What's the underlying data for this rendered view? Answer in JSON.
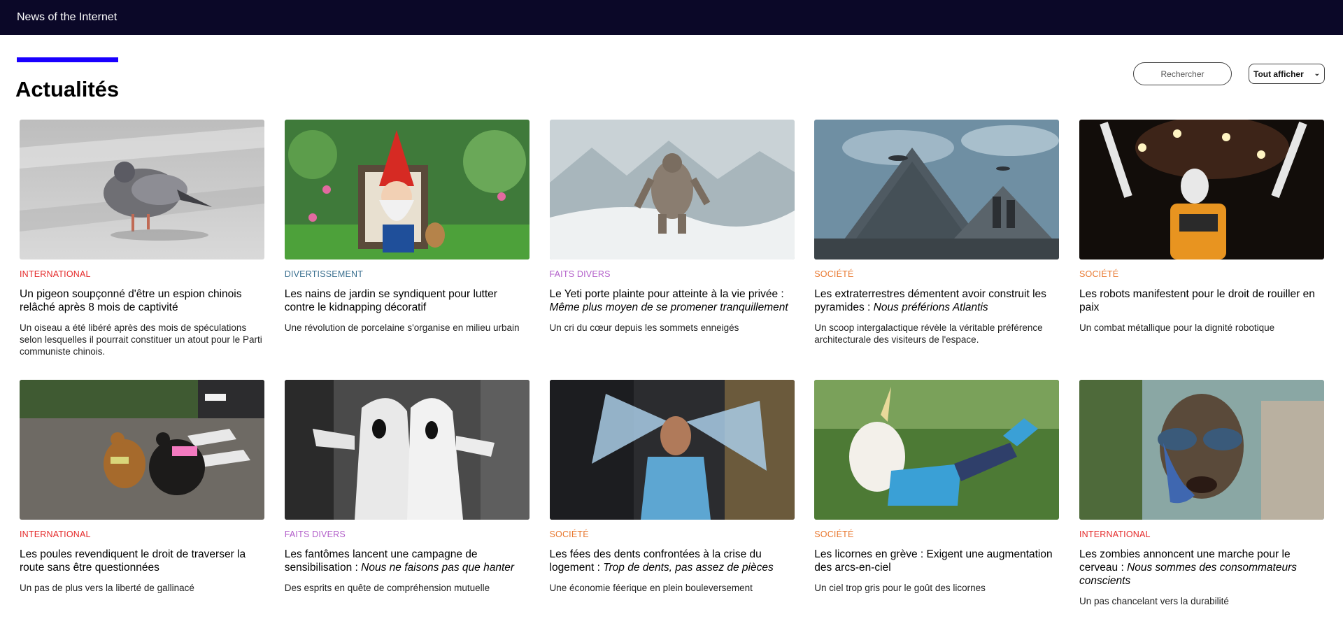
{
  "app": {
    "title": "News of the Internet"
  },
  "page": {
    "title": "Actualités"
  },
  "controls": {
    "search_label": "Rechercher",
    "filter_value": "Tout afficher"
  },
  "colors": {
    "topbar": "#0b0828",
    "accent": "#1a00ff",
    "international": "#e52b2b",
    "divertissement": "#3a6f8f",
    "faits_divers": "#b25ec9",
    "societe": "#e8772e"
  },
  "articles": [
    {
      "category": "INTERNATIONAL",
      "category_color": "#e52b2b",
      "title": "Un pigeon soupçonné d'être un espion chinois relâché après 8 mois de captivité",
      "title_italic": "",
      "desc": "Un oiseau a été libéré après des mois de spéculations selon lesquelles il pourrait constituer un atout pour le Parti communiste chinois.",
      "image": "pigeon"
    },
    {
      "category": "DIVERTISSEMENT",
      "category_color": "#3a6f8f",
      "title": "Les nains de jardin se syndiquent pour lutter contre le kidnapping décoratif",
      "title_italic": "",
      "desc": "Une révolution de porcelaine s'organise en milieu urbain",
      "image": "garden-gnome"
    },
    {
      "category": "FAITS DIVERS",
      "category_color": "#b25ec9",
      "title": "Le Yeti porte plainte pour atteinte à la vie privée : ",
      "title_italic": "Même plus moyen de se promener tranquillement",
      "desc": "Un cri du cœur depuis les sommets enneigés",
      "image": "yeti"
    },
    {
      "category": "SOCIÉTÉ",
      "category_color": "#e8772e",
      "title": "Les extraterrestres démentent avoir construit les pyramides : ",
      "title_italic": "Nous préférions Atlantis",
      "desc": "Un scoop intergalactique révèle la véritable préférence architecturale des visiteurs de l'espace.",
      "image": "pyramids-aliens"
    },
    {
      "category": "SOCIÉTÉ",
      "category_color": "#e8772e",
      "title": "Les robots manifestent pour le droit de rouiller en paix",
      "title_italic": "",
      "desc": "Un combat métallique pour la dignité robotique",
      "image": "robot"
    },
    {
      "category": "INTERNATIONAL",
      "category_color": "#e52b2b",
      "title": "Les poules revendiquent le droit de traverser la route sans être questionnées",
      "title_italic": "",
      "desc": "Un pas de plus vers la liberté de gallinacé",
      "image": "chickens"
    },
    {
      "category": "FAITS DIVERS",
      "category_color": "#b25ec9",
      "title": "Les fantômes lancent une campagne de sensibilisation : ",
      "title_italic": "Nous ne faisons pas que hanter",
      "desc": "Des esprits en quête de compréhension mutuelle",
      "image": "ghosts"
    },
    {
      "category": "SOCIÉTÉ",
      "category_color": "#e8772e",
      "title": "Les fées des dents confrontées à la crise du logement : ",
      "title_italic": "Trop de dents, pas assez de pièces",
      "desc": "Une économie féerique en plein bouleversement",
      "image": "tooth-fairy"
    },
    {
      "category": "SOCIÉTÉ",
      "category_color": "#e8772e",
      "title": "Les licornes en grève : Exigent une augmentation des arcs-en-ciel",
      "title_italic": "",
      "desc": "Un ciel trop gris pour le goût des licornes",
      "image": "unicorn-mask"
    },
    {
      "category": "INTERNATIONAL",
      "category_color": "#e52b2b",
      "title": "Les zombies annoncent une marche pour le cerveau : ",
      "title_italic": "Nous sommes des consommateurs conscients",
      "desc": "Un pas chancelant vers la durabilité",
      "image": "zombie"
    }
  ]
}
